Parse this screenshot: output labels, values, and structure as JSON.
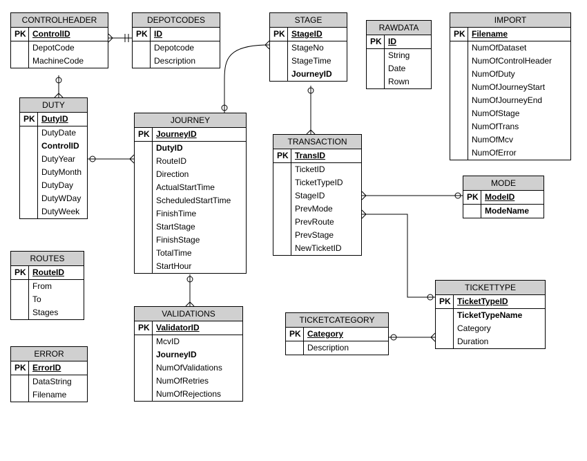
{
  "entities": {
    "controlheader": {
      "title": "CONTROLHEADER",
      "pk": "ControlID",
      "attrs": [
        "DepotCode",
        "MachineCode"
      ]
    },
    "depotcodes": {
      "title": "DEPOTCODES",
      "pk": "ID",
      "attrs": [
        "Depotcode",
        "Description"
      ]
    },
    "stage": {
      "title": "STAGE",
      "pk": "StageID",
      "attrs": [
        "StageNo",
        "StageTime"
      ],
      "fk_last": "JourneyID"
    },
    "rawdata": {
      "title": "RAWDATA",
      "pk": "ID",
      "attrs": [
        "String",
        "Date",
        "Rown"
      ]
    },
    "import": {
      "title": "IMPORT",
      "pk": "Filename",
      "attrs": [
        "NumOfDataset",
        "NumOfControlHeader",
        "NumOfDuty",
        "NumOfJourneyStart",
        "NumOfJourneyEnd",
        "NumOfStage",
        "NumOfTrans",
        "NumOfMcv",
        "NumOfError"
      ]
    },
    "duty": {
      "title": "DUTY",
      "pk": "DutyID",
      "attrs": [
        "DutyDate"
      ],
      "fk_mid": "ControlID",
      "attrs2": [
        "DutyYear",
        "DutyMonth",
        "DutyDay",
        "DutyWDay",
        "DutyWeek"
      ]
    },
    "journey": {
      "title": "JOURNEY",
      "pk": "JourneyID",
      "fk_first": "DutyID",
      "attrs": [
        "RouteID",
        "Direction",
        "ActualStartTime",
        "ScheduledStartTime",
        "FinishTime",
        "StartStage",
        "FinishStage",
        "TotalTime",
        "StartHour"
      ]
    },
    "transaction": {
      "title": "TRANSACTION",
      "pk": "TransID",
      "attrs": [
        "TicketID",
        "TicketTypeID",
        "StageID",
        "PrevMode",
        "PrevRoute",
        "PrevStage",
        "NewTicketID"
      ]
    },
    "mode": {
      "title": "MODE",
      "pk": "ModeID",
      "attrs_bold": "ModeName"
    },
    "routes": {
      "title": "ROUTES",
      "pk": "RouteID",
      "attrs": [
        "From",
        "To",
        "Stages"
      ]
    },
    "validations": {
      "title": "VALIDATIONS",
      "pk": "ValidatorID",
      "attrs": [
        "McvID"
      ],
      "fk_mid": "JourneyID",
      "attrs2": [
        "NumOfValidations",
        "NumOfRetries",
        "NumOfRejections"
      ]
    },
    "ticketcategory": {
      "title": "TICKETCATEGORY",
      "pk": "Category",
      "attrs": [
        "Description"
      ]
    },
    "tickettype": {
      "title": "TICKETTYPE",
      "pk": "TicketTypeID",
      "attrs_bold": "TicketTypeName",
      "attrs": [
        "Category",
        "Duration"
      ]
    },
    "error": {
      "title": "ERROR",
      "pk": "ErrorID",
      "attrs": [
        "DataString",
        "Filename"
      ]
    }
  },
  "labels": {
    "pk": "PK"
  }
}
